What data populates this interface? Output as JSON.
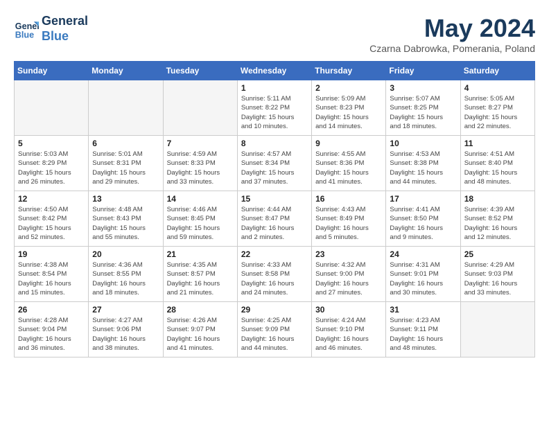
{
  "logo": {
    "line1": "General",
    "line2": "Blue"
  },
  "title": "May 2024",
  "subtitle": "Czarna Dabrowka, Pomerania, Poland",
  "weekdays": [
    "Sunday",
    "Monday",
    "Tuesday",
    "Wednesday",
    "Thursday",
    "Friday",
    "Saturday"
  ],
  "weeks": [
    [
      {
        "day": "",
        "info": ""
      },
      {
        "day": "",
        "info": ""
      },
      {
        "day": "",
        "info": ""
      },
      {
        "day": "1",
        "info": "Sunrise: 5:11 AM\nSunset: 8:22 PM\nDaylight: 15 hours\nand 10 minutes."
      },
      {
        "day": "2",
        "info": "Sunrise: 5:09 AM\nSunset: 8:23 PM\nDaylight: 15 hours\nand 14 minutes."
      },
      {
        "day": "3",
        "info": "Sunrise: 5:07 AM\nSunset: 8:25 PM\nDaylight: 15 hours\nand 18 minutes."
      },
      {
        "day": "4",
        "info": "Sunrise: 5:05 AM\nSunset: 8:27 PM\nDaylight: 15 hours\nand 22 minutes."
      }
    ],
    [
      {
        "day": "5",
        "info": "Sunrise: 5:03 AM\nSunset: 8:29 PM\nDaylight: 15 hours\nand 26 minutes."
      },
      {
        "day": "6",
        "info": "Sunrise: 5:01 AM\nSunset: 8:31 PM\nDaylight: 15 hours\nand 29 minutes."
      },
      {
        "day": "7",
        "info": "Sunrise: 4:59 AM\nSunset: 8:33 PM\nDaylight: 15 hours\nand 33 minutes."
      },
      {
        "day": "8",
        "info": "Sunrise: 4:57 AM\nSunset: 8:34 PM\nDaylight: 15 hours\nand 37 minutes."
      },
      {
        "day": "9",
        "info": "Sunrise: 4:55 AM\nSunset: 8:36 PM\nDaylight: 15 hours\nand 41 minutes."
      },
      {
        "day": "10",
        "info": "Sunrise: 4:53 AM\nSunset: 8:38 PM\nDaylight: 15 hours\nand 44 minutes."
      },
      {
        "day": "11",
        "info": "Sunrise: 4:51 AM\nSunset: 8:40 PM\nDaylight: 15 hours\nand 48 minutes."
      }
    ],
    [
      {
        "day": "12",
        "info": "Sunrise: 4:50 AM\nSunset: 8:42 PM\nDaylight: 15 hours\nand 52 minutes."
      },
      {
        "day": "13",
        "info": "Sunrise: 4:48 AM\nSunset: 8:43 PM\nDaylight: 15 hours\nand 55 minutes."
      },
      {
        "day": "14",
        "info": "Sunrise: 4:46 AM\nSunset: 8:45 PM\nDaylight: 15 hours\nand 59 minutes."
      },
      {
        "day": "15",
        "info": "Sunrise: 4:44 AM\nSunset: 8:47 PM\nDaylight: 16 hours\nand 2 minutes."
      },
      {
        "day": "16",
        "info": "Sunrise: 4:43 AM\nSunset: 8:49 PM\nDaylight: 16 hours\nand 5 minutes."
      },
      {
        "day": "17",
        "info": "Sunrise: 4:41 AM\nSunset: 8:50 PM\nDaylight: 16 hours\nand 9 minutes."
      },
      {
        "day": "18",
        "info": "Sunrise: 4:39 AM\nSunset: 8:52 PM\nDaylight: 16 hours\nand 12 minutes."
      }
    ],
    [
      {
        "day": "19",
        "info": "Sunrise: 4:38 AM\nSunset: 8:54 PM\nDaylight: 16 hours\nand 15 minutes."
      },
      {
        "day": "20",
        "info": "Sunrise: 4:36 AM\nSunset: 8:55 PM\nDaylight: 16 hours\nand 18 minutes."
      },
      {
        "day": "21",
        "info": "Sunrise: 4:35 AM\nSunset: 8:57 PM\nDaylight: 16 hours\nand 21 minutes."
      },
      {
        "day": "22",
        "info": "Sunrise: 4:33 AM\nSunset: 8:58 PM\nDaylight: 16 hours\nand 24 minutes."
      },
      {
        "day": "23",
        "info": "Sunrise: 4:32 AM\nSunset: 9:00 PM\nDaylight: 16 hours\nand 27 minutes."
      },
      {
        "day": "24",
        "info": "Sunrise: 4:31 AM\nSunset: 9:01 PM\nDaylight: 16 hours\nand 30 minutes."
      },
      {
        "day": "25",
        "info": "Sunrise: 4:29 AM\nSunset: 9:03 PM\nDaylight: 16 hours\nand 33 minutes."
      }
    ],
    [
      {
        "day": "26",
        "info": "Sunrise: 4:28 AM\nSunset: 9:04 PM\nDaylight: 16 hours\nand 36 minutes."
      },
      {
        "day": "27",
        "info": "Sunrise: 4:27 AM\nSunset: 9:06 PM\nDaylight: 16 hours\nand 38 minutes."
      },
      {
        "day": "28",
        "info": "Sunrise: 4:26 AM\nSunset: 9:07 PM\nDaylight: 16 hours\nand 41 minutes."
      },
      {
        "day": "29",
        "info": "Sunrise: 4:25 AM\nSunset: 9:09 PM\nDaylight: 16 hours\nand 44 minutes."
      },
      {
        "day": "30",
        "info": "Sunrise: 4:24 AM\nSunset: 9:10 PM\nDaylight: 16 hours\nand 46 minutes."
      },
      {
        "day": "31",
        "info": "Sunrise: 4:23 AM\nSunset: 9:11 PM\nDaylight: 16 hours\nand 48 minutes."
      },
      {
        "day": "",
        "info": ""
      }
    ]
  ]
}
